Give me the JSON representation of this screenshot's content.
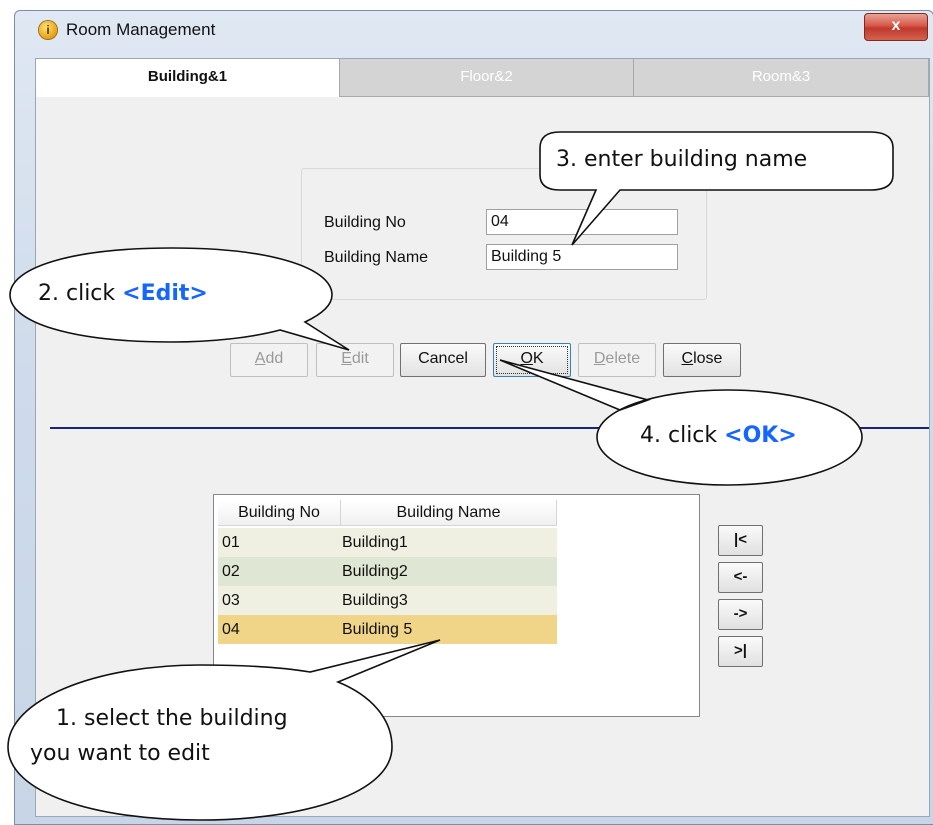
{
  "window": {
    "title": "Room Management",
    "close_glyph": "x"
  },
  "tabs": [
    {
      "label": "Building&1"
    },
    {
      "label": "Floor&2"
    },
    {
      "label": "Room&3"
    }
  ],
  "form": {
    "building_no_label": "Building No",
    "building_no_value": "04",
    "building_name_label": "Building Name",
    "building_name_value": "Building 5"
  },
  "buttons": {
    "add": "Add",
    "add_key": "A",
    "edit": "Edit",
    "edit_key": "E",
    "cancel": "Cancel",
    "ok": "OK",
    "ok_key": "O",
    "delete": "Delete",
    "delete_key": "D",
    "close": "Close",
    "close_key": "C"
  },
  "list": {
    "columns": [
      "Building No",
      "Building Name"
    ],
    "rows": [
      {
        "no": "01",
        "name": "Building1"
      },
      {
        "no": "02",
        "name": "Building2"
      },
      {
        "no": "03",
        "name": "Building3"
      },
      {
        "no": "04",
        "name": "Building 5"
      }
    ],
    "selected_index": 3
  },
  "nav_buttons": {
    "first": "|<",
    "prev": "<-",
    "next": "->",
    "last": ">|"
  },
  "callouts": {
    "step1_line1": "1. select the building",
    "step1_line2": "you want to edit",
    "step2_prefix": "2. click ",
    "step2_highlight": "<Edit>",
    "step3": "3. enter building name",
    "step4_prefix": "4. click ",
    "step4_highlight": "<OK>"
  },
  "colors": {
    "highlight": "#1565ff",
    "divider": "#1a237e",
    "selected_row": "#f0d488"
  }
}
